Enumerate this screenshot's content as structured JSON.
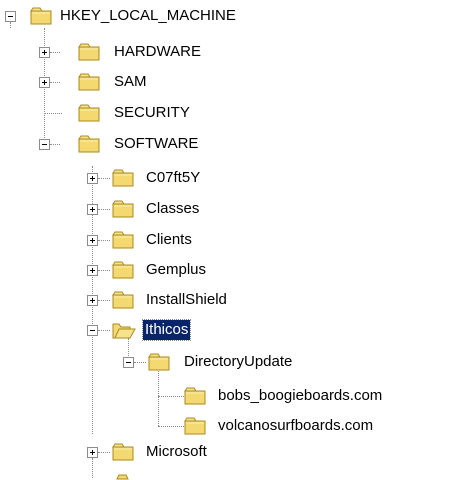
{
  "tree": {
    "root": {
      "label": "HKEY_LOCAL_MACHINE",
      "expanded": true,
      "icon": "folder-icon"
    },
    "hklm_children": [
      {
        "key": "hardware",
        "label": "HARDWARE",
        "expander": "plus"
      },
      {
        "key": "sam",
        "label": "SAM",
        "expander": "plus"
      },
      {
        "key": "security",
        "label": "SECURITY",
        "expander": "none"
      },
      {
        "key": "software",
        "label": "SOFTWARE",
        "expander": "minus"
      }
    ],
    "software_children": [
      {
        "key": "c07ft5y",
        "label": "C07ft5Y",
        "expander": "plus"
      },
      {
        "key": "classes",
        "label": "Classes",
        "expander": "plus"
      },
      {
        "key": "clients",
        "label": "Clients",
        "expander": "plus"
      },
      {
        "key": "gemplus",
        "label": "Gemplus",
        "expander": "plus"
      },
      {
        "key": "installshield",
        "label": "InstallShield",
        "expander": "plus"
      },
      {
        "key": "ithicos",
        "label": "Ithicos",
        "expander": "minus",
        "selected": true,
        "open_folder": true
      },
      {
        "key": "microsoft",
        "label": "Microsoft",
        "expander": "plus"
      }
    ],
    "ithicos_children": [
      {
        "key": "directoryupdate",
        "label": "DirectoryUpdate",
        "expander": "minus"
      }
    ],
    "directoryupdate_children": [
      {
        "key": "bobs",
        "label": "bobs_boogieboards.com",
        "expander": "none"
      },
      {
        "key": "volcano",
        "label": "volcanosurfboards.com",
        "expander": "none"
      }
    ]
  },
  "colors": {
    "folder_fill": "#f3d96f",
    "folder_stroke": "#a98b1e",
    "selection": "#0a246a",
    "tree_lines": "#8a8a8a"
  }
}
